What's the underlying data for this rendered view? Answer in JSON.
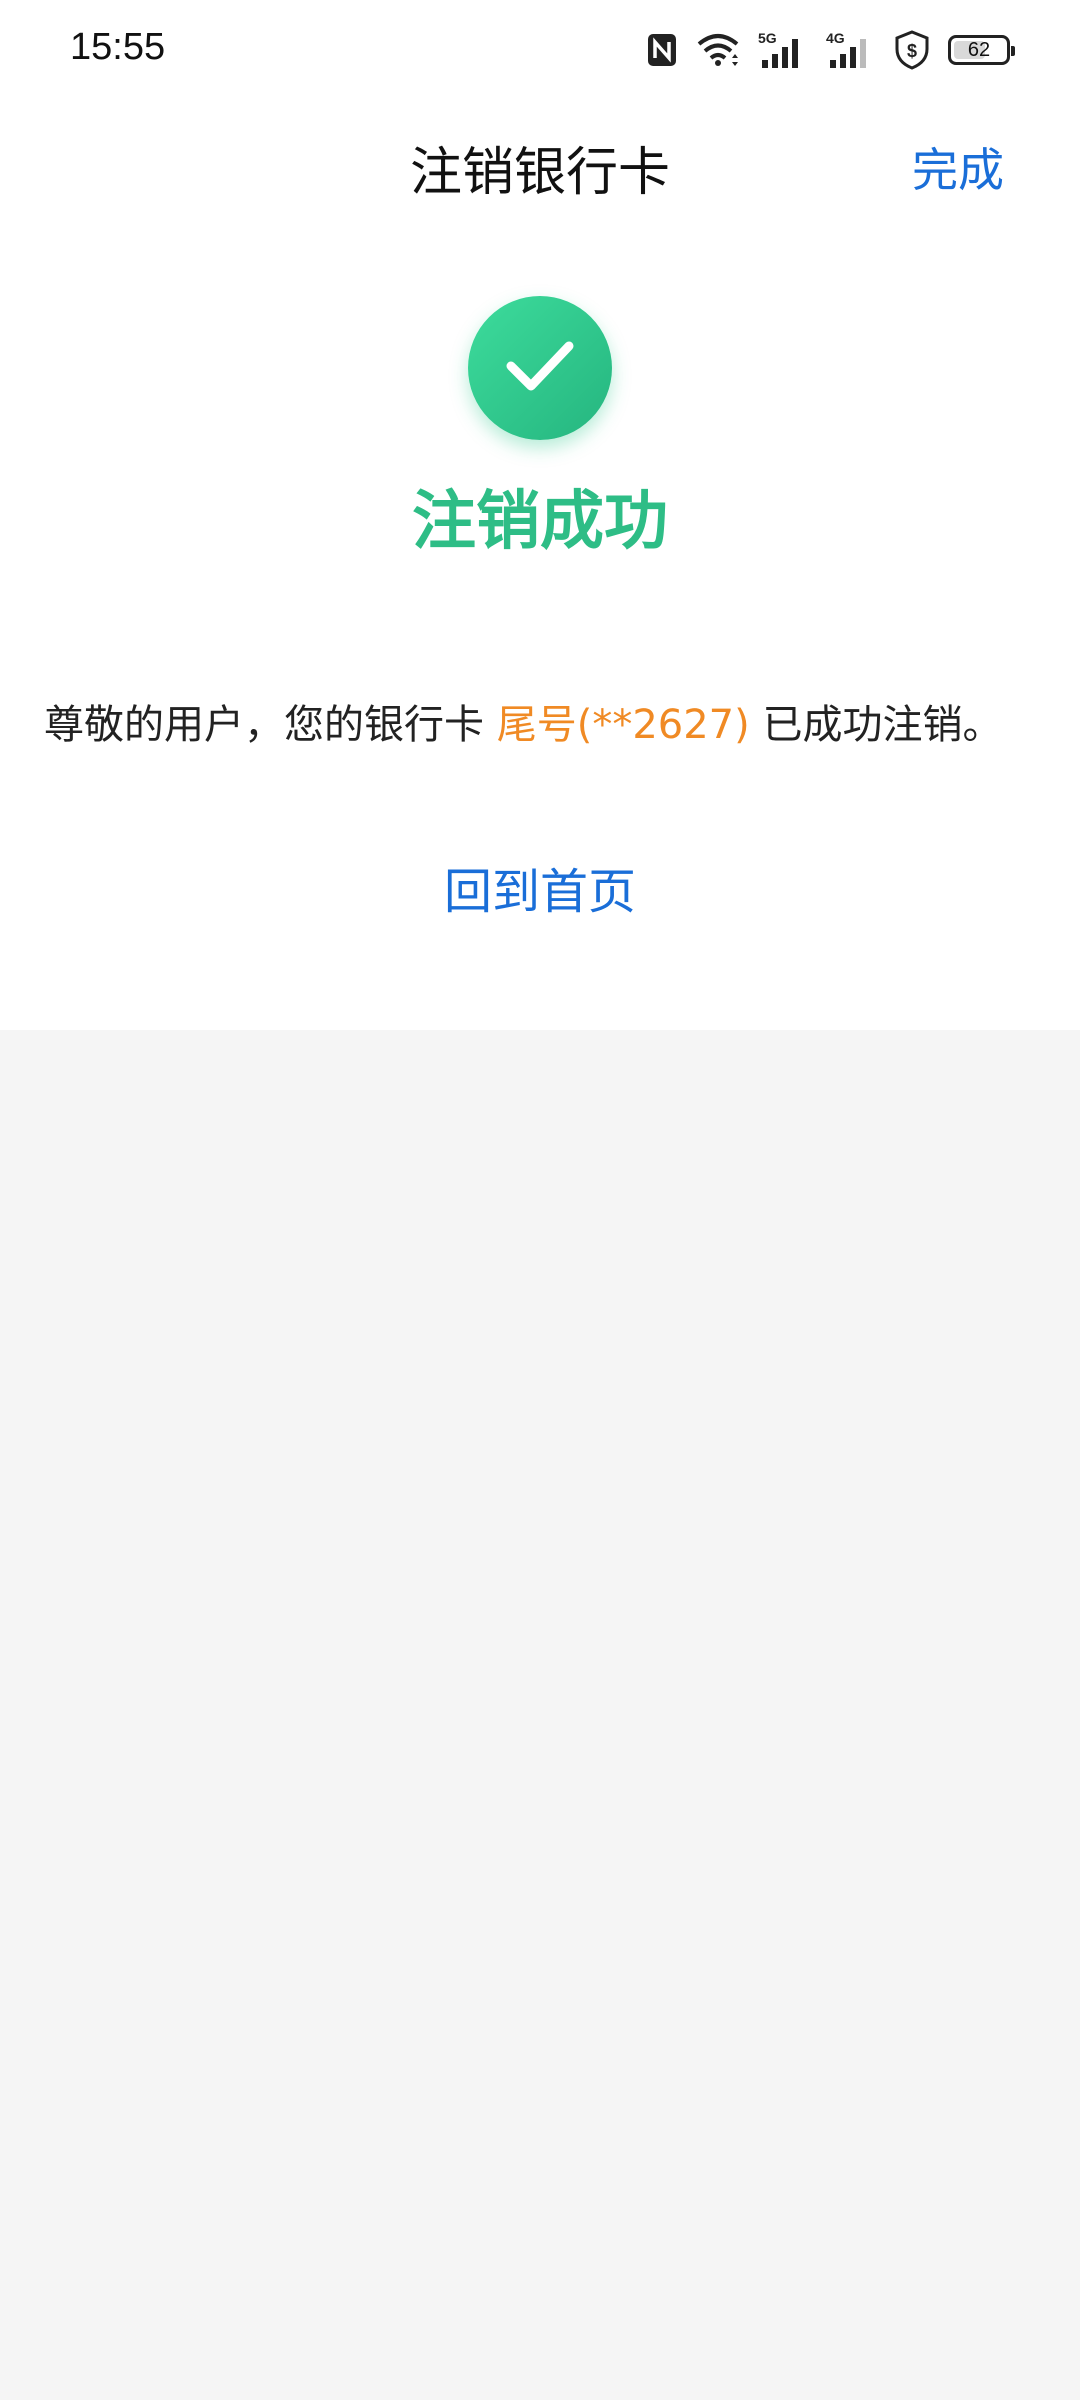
{
  "status_bar": {
    "time": "15:55",
    "icons": [
      "nfc-icon",
      "wifi-icon",
      "5g-signal-icon",
      "4g-signal-icon",
      "shield-dollar-icon",
      "battery-icon"
    ],
    "battery_level": "62",
    "network_5g": "5G",
    "network_4g": "4G"
  },
  "nav": {
    "title": "注销银行卡",
    "done_label": "完成"
  },
  "result": {
    "icon": "check-icon",
    "title": "注销成功",
    "message_prefix": "尊敬的用户，您的银行卡 ",
    "card_tail": "尾号(**2627)",
    "message_suffix": " 已成功注销。",
    "home_link": "回到首页"
  },
  "colors": {
    "success_green": "#2ebd86",
    "link_blue": "#1a6ed8",
    "highlight_orange": "#f08a24",
    "page_background": "#f5f5f5"
  }
}
